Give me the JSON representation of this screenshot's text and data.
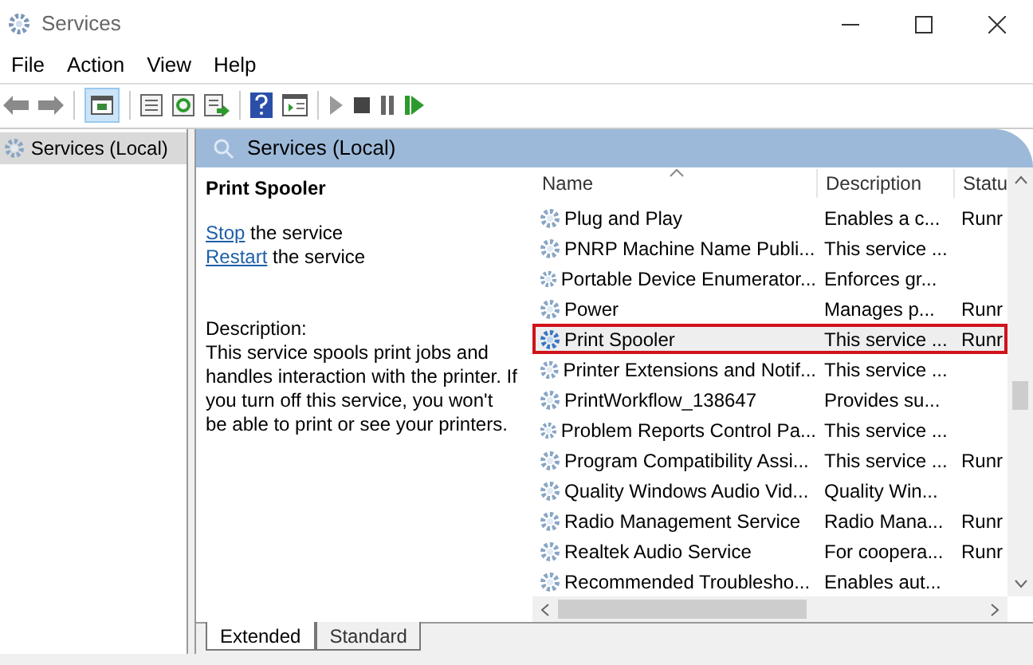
{
  "window": {
    "title": "Services"
  },
  "menu": [
    "File",
    "Action",
    "View",
    "Help"
  ],
  "tree": [
    {
      "label": "Services (Local)",
      "selected": true
    }
  ],
  "panel_header": "Services (Local)",
  "details": {
    "title": "Print Spooler",
    "actions": [
      {
        "link": "Stop",
        "text": "the service"
      },
      {
        "link": "Restart",
        "text": "the service"
      }
    ],
    "description_label": "Description:",
    "description": "This service spools print jobs and handles interaction with the printer. If you turn off this service, you won't be able to print or see your printers."
  },
  "table": {
    "columns": [
      "Name",
      "Description",
      "Statu"
    ],
    "rows": [
      {
        "name": "Plug and Play",
        "description": "Enables a c...",
        "status": "Runr",
        "selected": false
      },
      {
        "name": "PNRP Machine Name Publi...",
        "description": "This service ...",
        "status": "",
        "selected": false
      },
      {
        "name": "Portable Device Enumerator...",
        "description": "Enforces gr...",
        "status": "",
        "selected": false
      },
      {
        "name": "Power",
        "description": "Manages p...",
        "status": "Runr",
        "selected": false
      },
      {
        "name": "Print Spooler",
        "description": "This service ...",
        "status": "Runr",
        "selected": true
      },
      {
        "name": "Printer Extensions and Notif...",
        "description": "This service ...",
        "status": "",
        "selected": false
      },
      {
        "name": "PrintWorkflow_138647",
        "description": "Provides su...",
        "status": "",
        "selected": false
      },
      {
        "name": "Problem Reports Control Pa...",
        "description": "This service ...",
        "status": "",
        "selected": false
      },
      {
        "name": "Program Compatibility Assi...",
        "description": "This service ...",
        "status": "Runr",
        "selected": false
      },
      {
        "name": "Quality Windows Audio Vid...",
        "description": "Quality Win...",
        "status": "",
        "selected": false
      },
      {
        "name": "Radio Management Service",
        "description": "Radio Mana...",
        "status": "Runr",
        "selected": false
      },
      {
        "name": "Realtek Audio Service",
        "description": "For coopera...",
        "status": "Runr",
        "selected": false
      },
      {
        "name": "Recommended Troublesho...",
        "description": "Enables aut...",
        "status": "",
        "selected": false
      }
    ]
  },
  "tabs": [
    {
      "label": "Extended",
      "selected": true
    },
    {
      "label": "Standard",
      "selected": false
    }
  ]
}
